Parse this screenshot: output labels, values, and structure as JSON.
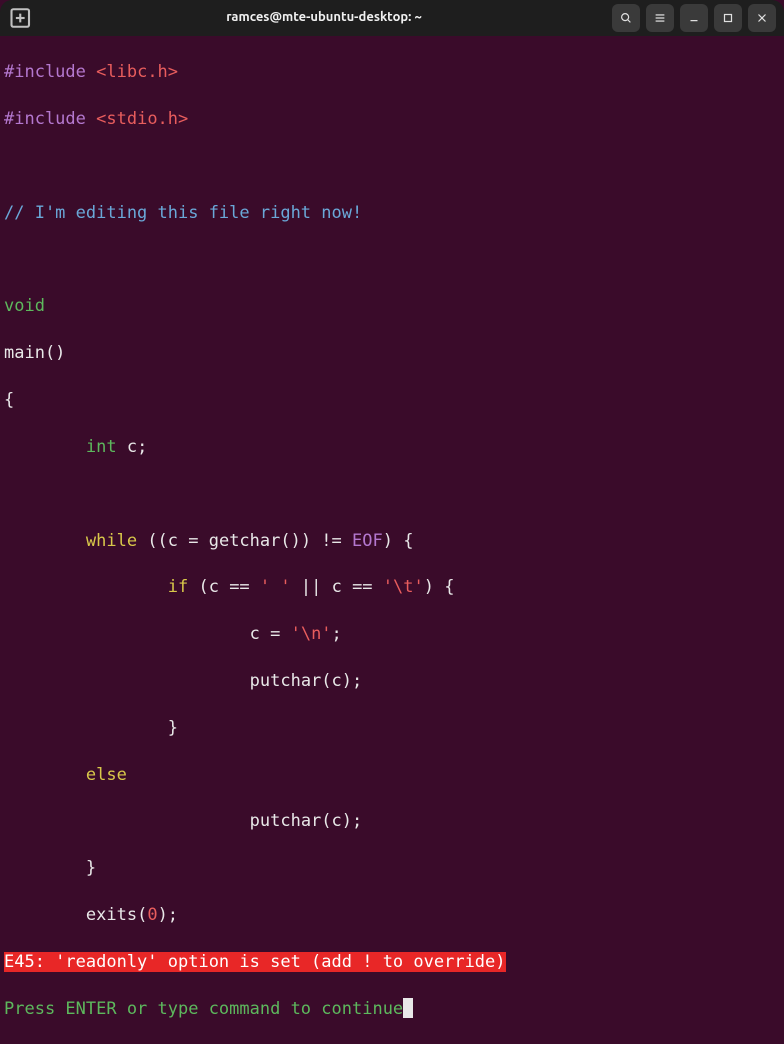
{
  "titlebar": {
    "title": "ramces@mte-ubuntu-desktop: ~"
  },
  "code": {
    "include1_pre": "#include",
    "include1_lib": "<libc.h>",
    "include2_pre": "#include",
    "include2_lib": "<stdio.h>",
    "comment": "// I'm editing this file right now!",
    "void": "void",
    "main": "main()",
    "brace_open": "{",
    "int_kw": "int",
    "int_rest": " c;",
    "while_kw": "while",
    "while_paren": " ((c = getchar()) != ",
    "eof": "EOF",
    "while_end": ") {",
    "if_kw": "if",
    "if_paren1": " (c == ",
    "quote_space": "' '",
    "if_or": " || c == ",
    "quote_tab": "'\\t'",
    "if_end": ") {",
    "assign_c": "c = ",
    "quote_nl": "'\\n'",
    "semicolon": ";",
    "putchar1": "putchar(c);",
    "brace_close1": "}",
    "else_kw": "else",
    "putchar2": "putchar(c);",
    "brace_close2": "}",
    "exits_pre": "exits(",
    "exits_arg": "0",
    "exits_post": ");"
  },
  "error": {
    "message": "E45: 'readonly' option is set (add ! to override)"
  },
  "prompt": {
    "message": "Press ENTER or type command to continue"
  }
}
